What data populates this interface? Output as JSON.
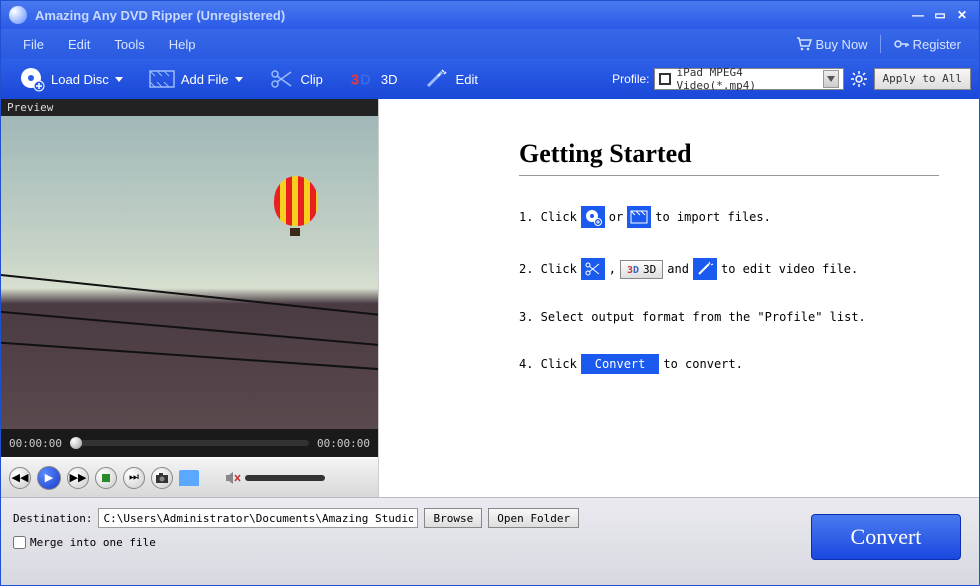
{
  "titlebar": {
    "title": "Amazing Any DVD Ripper (Unregistered)"
  },
  "menubar": {
    "items": [
      "File",
      "Edit",
      "Tools",
      "Help"
    ],
    "buy_now": "Buy Now",
    "register": "Register"
  },
  "toolbar": {
    "load_disc": "Load Disc",
    "add_file": "Add File",
    "clip": "Clip",
    "three_d": "3D",
    "edit": "Edit",
    "profile_label": "Profile:",
    "profile_value": "iPad MPEG4 Video(*.mp4)",
    "apply_all": "Apply to All"
  },
  "preview": {
    "label": "Preview",
    "time_start": "00:00:00",
    "time_end": "00:00:00"
  },
  "getting_started": {
    "heading": "Getting Started",
    "s1a": "1. Click",
    "s1_or": "or",
    "s1b": "to import files.",
    "s2a": "2. Click",
    "s2_comma": ",",
    "s2_3d": "3D",
    "s2_and": "and",
    "s2b": "to edit video file.",
    "s3": "3. Select output format from the \"Profile\" list.",
    "s4a": "4. Click",
    "s4_btn": "Convert",
    "s4b": "to convert."
  },
  "bottom": {
    "destination_label": "Destination:",
    "destination_path": "C:\\Users\\Administrator\\Documents\\Amazing Studio\\",
    "browse": "Browse",
    "open_folder": "Open Folder",
    "merge": "Merge into one file",
    "convert": "Convert"
  }
}
